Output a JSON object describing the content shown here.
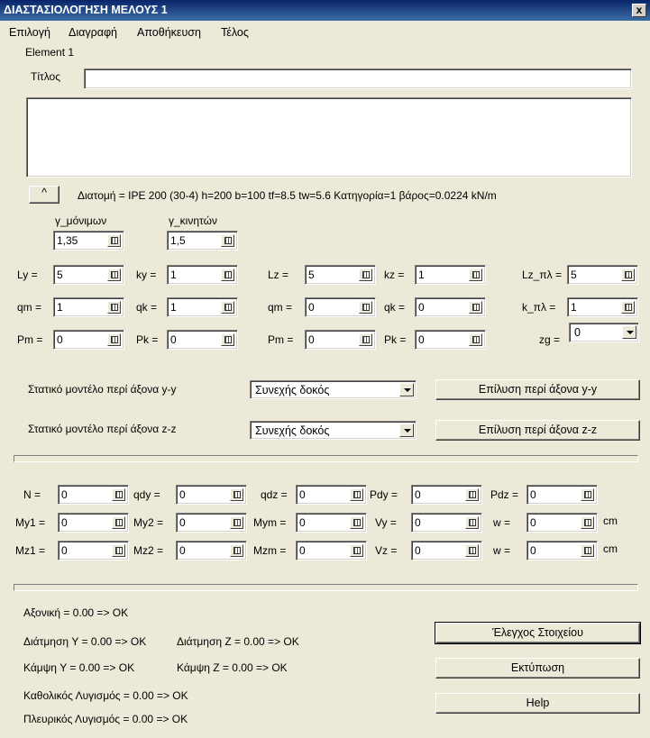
{
  "window": {
    "title": "ΔΙΑΣΤΑΣΙΟΛΟΓΗΣΗ ΜΕΛΟΥΣ 1",
    "close": "x"
  },
  "menu": [
    "Επιλογή",
    "Διαγραφή",
    "Αποθήκευση",
    "Τέλος"
  ],
  "element_label": "Element 1",
  "title_label": "Τίτλος",
  "title_value": "",
  "description_value": "",
  "collapse_button": "^",
  "section_info": "Διατομή = IPE 200 (30-4)  h=200  b=100  tf=8.5 tw=5.6  Κατηγορία=1  βάρος=0.0224 kN/m",
  "gamma": {
    "permanent_label": "γ_μόνιμων",
    "permanent_value": "1,35",
    "variable_label": "γ_κινητών",
    "variable_value": "1,5"
  },
  "params": {
    "Ly": {
      "label": "Ly =",
      "value": "5"
    },
    "ky": {
      "label": "ky =",
      "value": "1"
    },
    "Lz": {
      "label": "Lz =",
      "value": "5"
    },
    "kz": {
      "label": "kz =",
      "value": "1"
    },
    "Lzpl": {
      "label": "Lz_πλ =",
      "value": "5"
    },
    "qm1": {
      "label": "qm =",
      "value": "1"
    },
    "qk1": {
      "label": "qk =",
      "value": "1"
    },
    "qm2": {
      "label": "qm =",
      "value": "0"
    },
    "qk2": {
      "label": "qk =",
      "value": "0"
    },
    "kpl": {
      "label": "k_πλ =",
      "value": "1"
    },
    "Pm1": {
      "label": "Pm =",
      "value": "0"
    },
    "Pk1": {
      "label": "Pk =",
      "value": "0"
    },
    "Pm2": {
      "label": "Pm =",
      "value": "0"
    },
    "Pk2": {
      "label": "Pk =",
      "value": "0"
    },
    "zg": {
      "label": "zg =",
      "value": "0"
    }
  },
  "static_y": {
    "label": "Στατικό μοντέλο περί άξονα y-y",
    "value": "Συνεχής δοκός",
    "button": "Επίλυση περί άξονα y-y"
  },
  "static_z": {
    "label": "Στατικό μοντέλο περί άξονα z-z",
    "value": "Συνεχής δοκός",
    "button": "Επίλυση περί άξονα z-z"
  },
  "forces": {
    "N": {
      "label": "N =",
      "value": "0"
    },
    "qdy": {
      "label": "qdy =",
      "value": "0"
    },
    "qdz": {
      "label": "qdz =",
      "value": "0"
    },
    "Pdy": {
      "label": "Pdy =",
      "value": "0"
    },
    "Pdz": {
      "label": "Pdz =",
      "value": "0"
    },
    "My1": {
      "label": "My1 =",
      "value": "0"
    },
    "My2": {
      "label": "My2 =",
      "value": "0"
    },
    "Mym": {
      "label": "Mym =",
      "value": "0"
    },
    "Vy": {
      "label": "Vy =",
      "value": "0"
    },
    "wy": {
      "label": "w =",
      "value": "0"
    },
    "Mz1": {
      "label": "Mz1 =",
      "value": "0"
    },
    "Mz2": {
      "label": "Mz2 =",
      "value": "0"
    },
    "Mzm": {
      "label": "Mzm =",
      "value": "0"
    },
    "Vz": {
      "label": "Vz =",
      "value": "0"
    },
    "wz": {
      "label": "w  =",
      "value": "0"
    },
    "unit": "cm"
  },
  "results": {
    "axial": "Αξονική = 0.00 => OK",
    "shear_y": "Διάτμηση Y = 0.00 => OK",
    "shear_z": "Διάτμηση Z = 0.00 => OK",
    "bending_y": "Κάμψη Y = 0.00 => OK",
    "bending_z": "Κάμψη Z = 0.00 => OK",
    "global_buckling": "Καθολικός Λυγισμός = 0.00 => OK",
    "lateral_buckling": "Πλευρικός Λυγισμός = 0.00 => OK"
  },
  "buttons": {
    "check": "Έλεγχος Στοιχείου",
    "print": "Εκτύπωση",
    "help": "Help"
  }
}
